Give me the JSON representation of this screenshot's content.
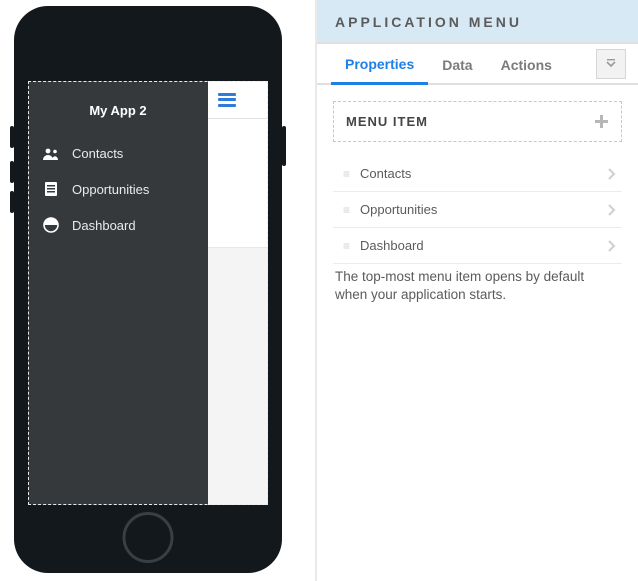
{
  "panel": {
    "title": "APPLICATION MENU",
    "tabs": {
      "properties": "Properties",
      "data": "Data",
      "actions": "Actions"
    },
    "section_title": "MENU ITEM",
    "help_text": "The top-most menu item opens by default when your application starts."
  },
  "menu_items": [
    {
      "label": "Contacts"
    },
    {
      "label": "Opportunities"
    },
    {
      "label": "Dashboard"
    }
  ],
  "app": {
    "title": "My App 2",
    "drawer": [
      {
        "label": "Contacts"
      },
      {
        "label": "Opportunities"
      },
      {
        "label": "Dashboard"
      }
    ]
  }
}
